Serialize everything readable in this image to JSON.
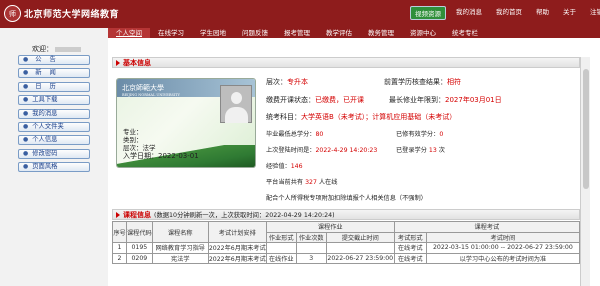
{
  "header": {
    "logo_text": "北京师范大学网络教育",
    "seal": "师"
  },
  "topbar": {
    "items": [
      "视频资源",
      "我的消息",
      "我的首页",
      "帮助",
      "关于",
      "注销"
    ]
  },
  "nav": {
    "items": [
      "个人空间",
      "在线学习",
      "学生园地",
      "问题反馈",
      "报考管理",
      "教学评估",
      "教务管理",
      "资源中心",
      "统考专栏"
    ],
    "active": 0
  },
  "welcome": {
    "label": "欢迎："
  },
  "menu": {
    "items": [
      "公  告",
      "新  闻",
      "日  历",
      "工具下载",
      "我的消息",
      "个人文件夹",
      "个人信息",
      "修改密码",
      "页面风格"
    ]
  },
  "basic": {
    "title": "基本信息"
  },
  "card": {
    "school": "北京師範大學",
    "school_en": "BEIJING NORMAL UNIVERSITY",
    "major": "专业：",
    "category": "类别：",
    "level": "层次：法学",
    "enroll": "入学日期：2022-03-01"
  },
  "info": {
    "level_label": "层次：",
    "level": "专升本",
    "prev_label": "前置学历核查结果：",
    "prev": "相符",
    "fee_label": "缴费开课状态：",
    "fee": "已缴费，已开课",
    "grad_label": "最长修业年限到：",
    "grad": "2027年03月01日",
    "exam_label": "统考科目：",
    "exam": "大学英语B（未考试）；计算机应用基础（未考试）",
    "credit_min_label": "毕业最低总学分：",
    "credit_min": "80",
    "credit_got_label": "已修有效学分：",
    "credit_got": "0",
    "last_login_label": "上次登陆时间是：",
    "last_login": "2022-4-29 14:20:23",
    "course_credit_label": "已登录学分",
    "course_credit": "13",
    "course_credit_unit": "次",
    "exp_label": "经验值：",
    "exp": "146",
    "online_pre": "平台当前共有",
    "online": "327",
    "online_post": "人在线",
    "notice": "配合个人所得税专项附加扣除填报个人相关信息（不强制）"
  },
  "course": {
    "title": "课程信息",
    "note": "(数据10分钟刷新一次，上次获取时间：2022-04-29 14:20:24)"
  },
  "table": {
    "headers": [
      "序号",
      "课程代码",
      "课程名称",
      "考试计划安排",
      "课程作业",
      "课程考试"
    ],
    "sub_headers": [
      "作业形式",
      "作业次数",
      "提交截止时间",
      "考试形式",
      "考试时间"
    ],
    "rows": [
      [
        "1",
        "0195",
        "网络教育学习指导",
        "2022年6月期末考试",
        "",
        "",
        "",
        "在线考试",
        "2022-03-15 01:00:00 -- 2022-06-27 23:59:00"
      ],
      [
        "2",
        "0209",
        "宪法学",
        "2022年6月期末考试",
        "在线作业",
        "3",
        "2022-06-27 23:59:00",
        "在线考试",
        "以学习中心公布的考试时间为准"
      ]
    ]
  }
}
